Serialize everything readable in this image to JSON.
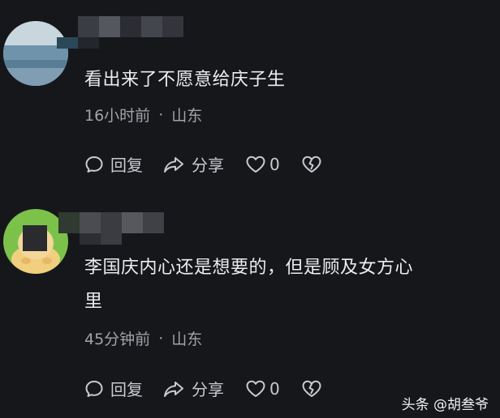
{
  "comments": [
    {
      "text": "看出来了不愿意给庆子生",
      "time": "16小时前",
      "separator": "·",
      "location": "山东",
      "reply_label": "回复",
      "share_label": "分享",
      "like_count": "0"
    },
    {
      "text_line1": "李国庆内心还是想要的，但是顾及女方心",
      "text_line2": "里",
      "time": "45分钟前",
      "separator": "·",
      "location": "山东",
      "reply_label": "回复",
      "share_label": "分享",
      "like_count": "0"
    }
  ],
  "watermark": "头条 @胡叁爷",
  "icons": {
    "reply": "comment-bubble-icon",
    "share": "share-arrow-icon",
    "like": "heart-icon",
    "dislike": "broken-heart-icon"
  },
  "colors": {
    "background": "#16171b",
    "text": "#ececee",
    "meta": "#a2a3a8"
  }
}
